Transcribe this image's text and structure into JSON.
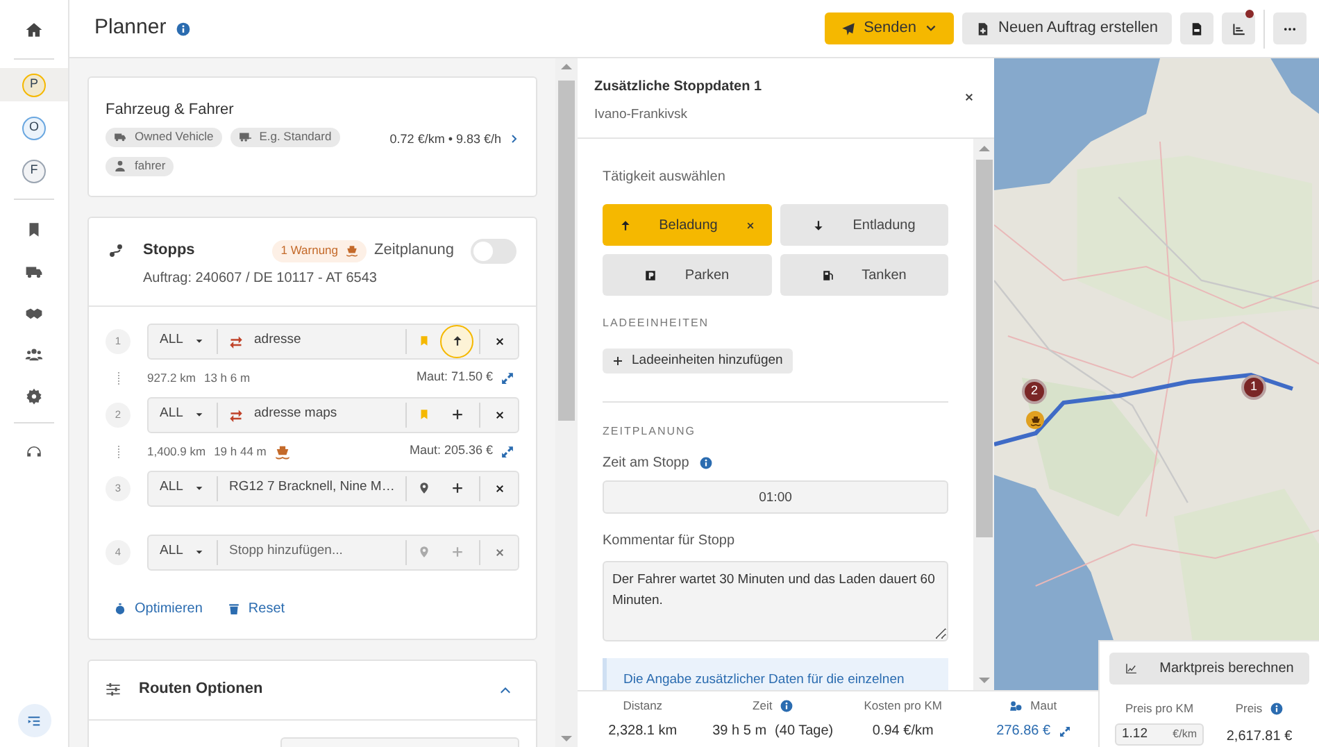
{
  "sidebar": {
    "profiles": [
      {
        "label": "P",
        "selected": true,
        "color": "#f5b800"
      },
      {
        "label": "O",
        "selected": false,
        "color": "#6aa7e0"
      },
      {
        "label": "F",
        "selected": false,
        "color": "#9aa4b1"
      }
    ]
  },
  "header": {
    "title": "Planner",
    "send_button": "Senden",
    "new_order_button": "Neuen Auftrag erstellen",
    "chart_notification": true
  },
  "vehicle": {
    "title": "Fahrzeug & Fahrer",
    "tags": [
      {
        "kind": "truck",
        "label": "Owned Vehicle"
      },
      {
        "kind": "trailer",
        "label": "E.g. Standard"
      },
      {
        "kind": "person",
        "label": "fahrer"
      }
    ],
    "rate": "0.72 €/km • 9.83 €/h"
  },
  "stops": {
    "title": "Stopps",
    "warning": "1 Warnung",
    "scheduling_label": "Zeitplanung",
    "scheduling_on": false,
    "order": "Auftrag: 240607 / DE 10117 - AT 6543",
    "items": [
      {
        "number": "1",
        "type": "ALL",
        "address": "adresse",
        "marker": {
          "kind": "bookmark"
        },
        "action": {
          "kind": "up"
        },
        "action_active": true,
        "leg": {
          "distance": "927.2 km",
          "time": "13 h 6 m",
          "ferry": false,
          "toll": "Maut: 71.50 €"
        }
      },
      {
        "number": "2",
        "type": "ALL",
        "address": "adresse maps",
        "marker": {
          "kind": "bookmark"
        },
        "action": {
          "kind": "plus"
        },
        "action_active": false,
        "leg": {
          "distance": "1,400.9 km",
          "time": "19 h 44 m",
          "ferry": true,
          "toll": "Maut: 205.36 €"
        }
      },
      {
        "number": "3",
        "type": "ALL",
        "address": "RG12 7 Bracknell, Nine M…",
        "marker": {
          "kind": "pin"
        },
        "action": {
          "kind": "plus"
        },
        "action_active": false
      },
      {
        "number": "4",
        "type": "ALL",
        "placeholder": "Stopp hinzufügen...",
        "marker": {
          "kind": "pin"
        },
        "action": {
          "kind": "plus"
        },
        "action_active": false
      }
    ],
    "optimize": "Optimieren",
    "reset": "Reset"
  },
  "route_options": {
    "title": "Routen Optionen",
    "expanded": true
  },
  "map": {
    "markers": [
      {
        "label": "2",
        "ferry": true
      },
      {
        "label": "1",
        "ferry": false
      }
    ]
  },
  "stop_details": {
    "title": "Zusätzliche Stoppdaten 1",
    "subtitle": "Ivano-Frankivsk",
    "activity_label": "Tätigkeit auswählen",
    "activities": [
      {
        "kind": "up",
        "label": "Beladung",
        "selected": true
      },
      {
        "kind": "down",
        "label": "Entladung",
        "selected": false
      },
      {
        "kind": "parking",
        "label": "Parken",
        "selected": false
      },
      {
        "kind": "fuel",
        "label": "Tanken",
        "selected": false
      }
    ],
    "units_heading": "LADEEINHEITEN",
    "units_button": "Ladeeinheiten hinzufügen",
    "schedule_heading": "ZEITPLANUNG",
    "time_label": "Zeit am Stopp",
    "time_value": "01:00",
    "comment_label": "Kommentar für Stopp",
    "comment": "Der Fahrer wartet 30 Minuten und das Laden dauert 60 Minuten.",
    "notice": "Die Angabe zusätzlicher Daten für die einzelnen"
  },
  "summary": [
    {
      "kind": "plain",
      "label": "Distanz",
      "value": "2,328.1 km"
    },
    {
      "kind": "info",
      "label": "Zeit",
      "value": "39 h 5 m",
      "extra": "(40 Tage)"
    },
    {
      "kind": "plain",
      "label": "Kosten pro KM",
      "value": "0.94 €/km"
    },
    {
      "kind": "toll",
      "label": "Maut",
      "value": "276.86 €"
    }
  ],
  "pricing": {
    "market_button": "Marktpreis berechnen",
    "per_km_label": "Preis pro KM",
    "per_km_value": "1.12",
    "per_km_unit": "€/km",
    "price_label": "Preis",
    "price": "2,617.81 €"
  }
}
